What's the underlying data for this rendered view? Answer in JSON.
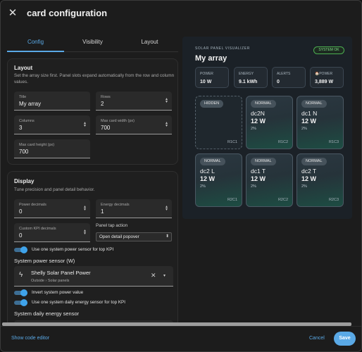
{
  "header": {
    "title": "card configuration"
  },
  "tabs": [
    {
      "label": "Config"
    },
    {
      "label": "Visibility"
    },
    {
      "label": "Layout"
    }
  ],
  "layout_section": {
    "title": "Layout",
    "description": "Set the array size first. Panel slots expand automatically from the row and column values.",
    "fields": {
      "title": {
        "label": "Title",
        "value": "My array"
      },
      "rows": {
        "label": "Rows",
        "value": "2"
      },
      "columns": {
        "label": "Columns",
        "value": "3"
      },
      "max_width": {
        "label": "Max card width (px)",
        "value": "700"
      },
      "max_height": {
        "label": "Max card height (px)",
        "value": "700"
      }
    }
  },
  "display_section": {
    "title": "Display",
    "description": "Tune precision and panel detail behavior.",
    "fields": {
      "power_decimals": {
        "label": "Power decimals",
        "value": "0"
      },
      "energy_decimals": {
        "label": "Energy decimals",
        "value": "1"
      },
      "custom_kpi_decimals": {
        "label": "Custom KPI decimals",
        "value": "0"
      }
    },
    "panel_tap_action": {
      "label": "Panel tap action",
      "value": "Open detail popover"
    },
    "toggle_system_power": "Use one system power sensor for top KPI",
    "system_power_sensor_label": "System power sensor (W)",
    "entity": {
      "name": "Shelly Solar Panel Power",
      "path": "Outside › Solar panels"
    },
    "toggle_invert": "Invert system power value",
    "toggle_daily_energy": "Use one system daily energy sensor for top KPI",
    "daily_energy_label": "System daily energy sensor"
  },
  "footer": {
    "show_code": "Show code editor",
    "cancel": "Cancel",
    "save": "Save"
  },
  "preview": {
    "subtitle": "SOLAR PANEL VISUALIZER",
    "title": "My array",
    "status": "SYSTEM OK",
    "kpis": [
      {
        "label": "POWER",
        "value": "10 W"
      },
      {
        "label": "ENERGY",
        "value": "9.1 kWh"
      },
      {
        "label": "ALERTS",
        "value": "0"
      },
      {
        "label": "🏠POWER",
        "value": "3,889 W"
      }
    ],
    "panels": [
      {
        "badge": "HIDDEN",
        "name": "",
        "power": "",
        "percent": "",
        "position": "R1C1"
      },
      {
        "badge": "NORMAL",
        "name": "dc2N",
        "power": "12 W",
        "percent": "2%",
        "position": "R1C2"
      },
      {
        "badge": "NORMAL",
        "name": "dc1 N",
        "power": "12 W",
        "percent": "2%",
        "position": "R1C3"
      },
      {
        "badge": "NORMAL",
        "name": "dc2 L",
        "power": "12 W",
        "percent": "2%",
        "position": "R2C1"
      },
      {
        "badge": "NORMAL",
        "name": "dc1 T",
        "power": "12 W",
        "percent": "2%",
        "position": "R2C2"
      },
      {
        "badge": "NORMAL",
        "name": "dc2 T",
        "power": "12 W",
        "percent": "2%",
        "position": "R2C3"
      }
    ]
  },
  "colors": {
    "accent": "#5aa9e6",
    "status_ok": "#4caf50",
    "toggle_on": "#3fa3ea"
  },
  "icons": {
    "close": "close-icon",
    "clear": "clear-icon",
    "dropdown": "chevron-down-icon",
    "entity": "lightning-icon"
  }
}
